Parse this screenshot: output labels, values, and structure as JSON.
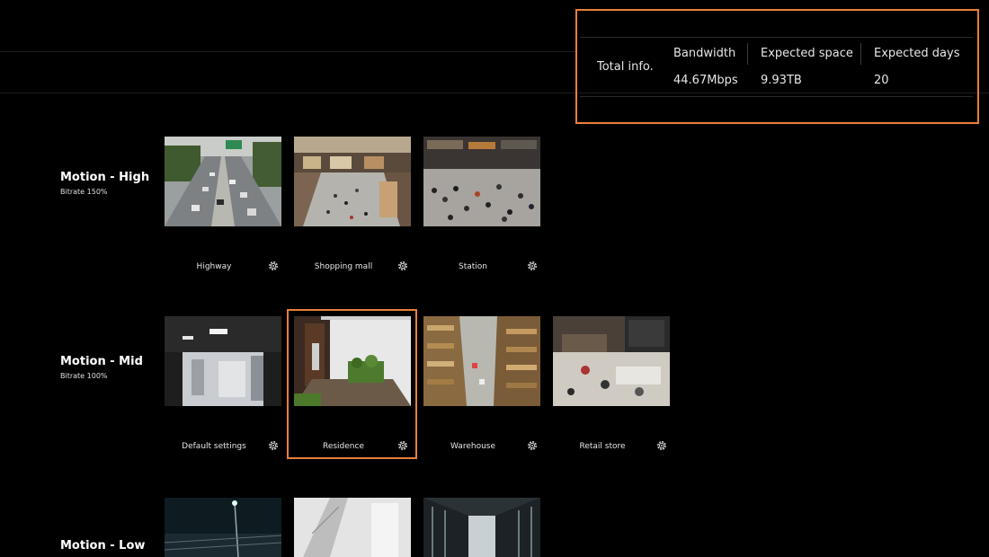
{
  "total_info": {
    "title": "Total info.",
    "columns": [
      {
        "header": "Bandwidth",
        "value": "44.67Mbps"
      },
      {
        "header": "Expected space",
        "value": "9.93TB"
      },
      {
        "header": "Expected days",
        "value": "20"
      }
    ]
  },
  "rows": [
    {
      "title": "Motion - High",
      "bitrate": "Bitrate  150%",
      "cards": [
        {
          "name": "Highway",
          "icon": "gear-icon"
        },
        {
          "name": "Shopping mall",
          "icon": "gear-icon"
        },
        {
          "name": "Station",
          "icon": "gear-icon"
        }
      ]
    },
    {
      "title": "Motion - Mid",
      "bitrate": "Bitrate  100%",
      "cards": [
        {
          "name": "Default settings",
          "icon": "gear-icon"
        },
        {
          "name": "Residence",
          "icon": "gear-icon",
          "selected": true
        },
        {
          "name": "Warehouse",
          "icon": "gear-icon"
        },
        {
          "name": "Retail store",
          "icon": "gear-icon"
        }
      ]
    },
    {
      "title": "Motion - Low",
      "bitrate": "",
      "cards": []
    }
  ],
  "colors": {
    "accent": "#e8803a",
    "background": "#000000"
  }
}
